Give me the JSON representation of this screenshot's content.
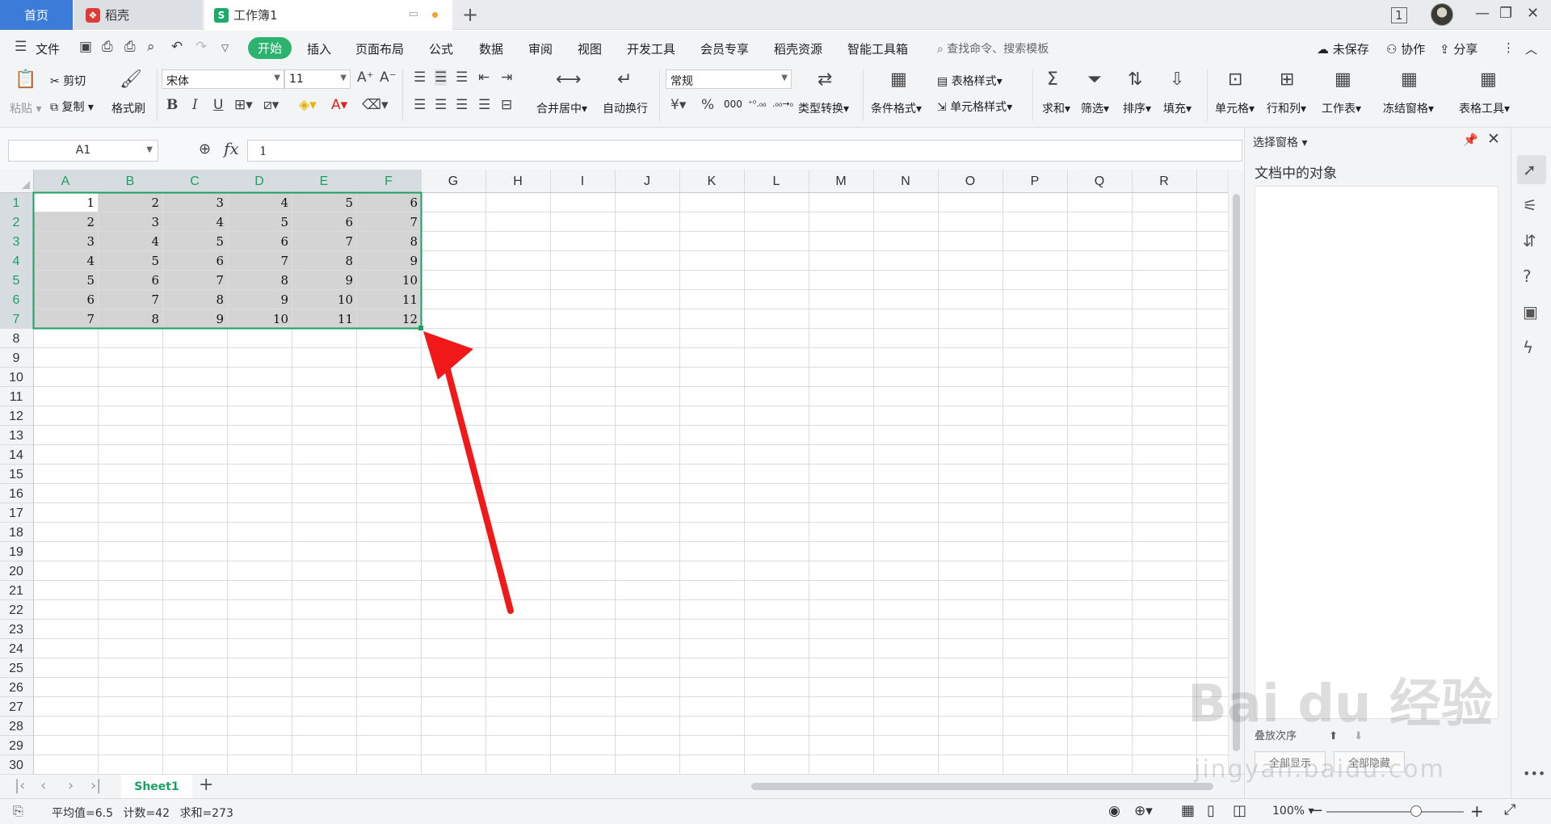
{
  "tabs": {
    "home": "首页",
    "docer": "稻壳",
    "document": "工作簿1"
  },
  "menu": {
    "file": "文件",
    "items": [
      "开始",
      "插入",
      "页面布局",
      "公式",
      "数据",
      "审阅",
      "视图",
      "开发工具",
      "会员专享",
      "稻壳资源",
      "智能工具箱"
    ],
    "search_placeholder": "查找命令、搜索模板",
    "unsaved": "未保存",
    "collaborate": "协作",
    "share": "分享"
  },
  "ribbon": {
    "paste": "粘贴",
    "cut": "剪切",
    "copy": "复制",
    "format_painter": "格式刷",
    "font_name": "宋体",
    "font_size": "11",
    "bold": "B",
    "italic": "I",
    "underline": "U",
    "merge_center": "合并居中",
    "wrap_text": "自动换行",
    "number_format": "常规",
    "currency": "¥",
    "percent": "%",
    "thousands": "000",
    "type_convert": "类型转换",
    "conditional_format": "条件格式",
    "table_style": "表格样式",
    "cell_style": "单元格样式",
    "sum": "求和",
    "filter": "筛选",
    "sort": "排序",
    "fill": "填充",
    "cell": "单元格",
    "row_col": "行和列",
    "worksheet": "工作表",
    "freeze": "冻结窗格",
    "table_tools": "表格工具"
  },
  "formula_bar": {
    "cell_ref": "A1",
    "fx": "fx",
    "value": "1"
  },
  "grid": {
    "columns": [
      "A",
      "B",
      "C",
      "D",
      "E",
      "F",
      "G",
      "H",
      "I",
      "J",
      "K",
      "L",
      "M",
      "N",
      "O",
      "P",
      "Q",
      "R"
    ],
    "row_count": 30,
    "cells": [
      [
        1,
        2,
        3,
        4,
        5,
        6
      ],
      [
        2,
        3,
        4,
        5,
        6,
        7
      ],
      [
        3,
        4,
        5,
        6,
        7,
        8
      ],
      [
        4,
        5,
        6,
        7,
        8,
        9
      ],
      [
        5,
        6,
        7,
        8,
        9,
        10
      ],
      [
        6,
        7,
        8,
        9,
        10,
        11
      ],
      [
        7,
        8,
        9,
        10,
        11,
        12
      ]
    ],
    "selection": "A1:F7",
    "selection_color": "#1aa064",
    "selection_fill": "#d4d4d4",
    "arrow_color": "#f01818"
  },
  "sheets": {
    "active": "Sheet1"
  },
  "status": {
    "average": "平均值=6.5",
    "count": "计数=42",
    "sum": "求和=273",
    "zoom": "100%"
  },
  "pane": {
    "title": "选择窗格",
    "heading": "文档中的对象",
    "sort_label": "叠放次序",
    "show_all": "全部显示",
    "hide_all": "全部隐藏"
  },
  "watermark": {
    "main": "Bai du 经验",
    "sub": "jingyan.baidu.com"
  }
}
